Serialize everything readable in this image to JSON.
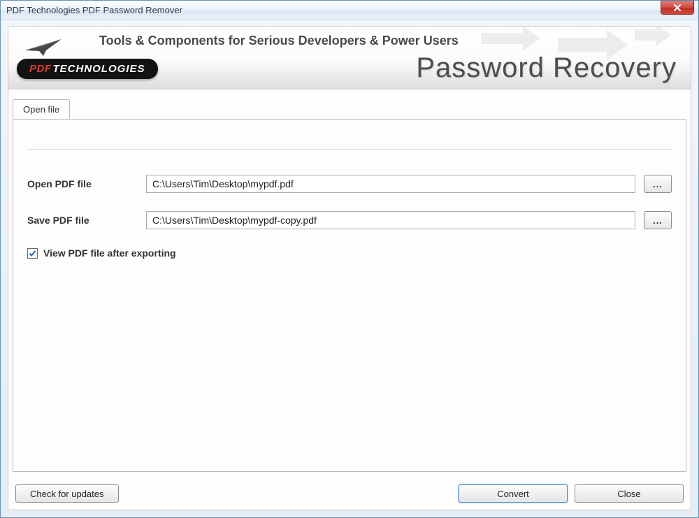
{
  "titlebar": {
    "title": "PDF Technologies PDF Password Remover"
  },
  "header": {
    "brand_pdf": "PDF",
    "brand_tech": "TECHNOLOGIES",
    "tagline": "Tools & Components for Serious Developers & Power Users",
    "app_name": "Password Recovery"
  },
  "tab": {
    "label": "Open file"
  },
  "form": {
    "open_label": "Open PDF file",
    "open_value": "C:\\Users\\Tim\\Desktop\\mypdf.pdf",
    "save_label": "Save PDF file",
    "save_value": "C:\\Users\\Tim\\Desktop\\mypdf-copy.pdf",
    "browse_label": "...",
    "view_after_label": "View PDF file after exporting",
    "view_after_checked": true
  },
  "footer": {
    "updates_label": "Check for updates",
    "convert_label": "Convert",
    "close_label": "Close"
  }
}
